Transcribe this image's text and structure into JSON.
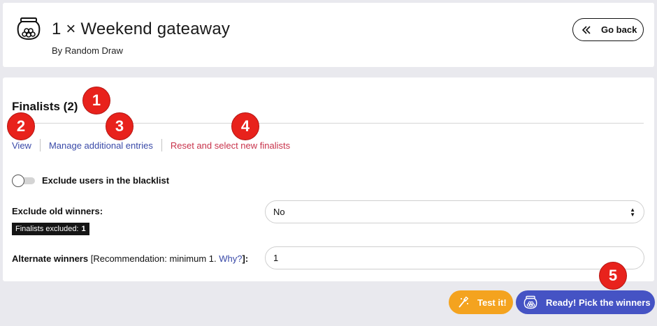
{
  "header": {
    "title": "1 × Weekend gateaway",
    "subtitle": "By Random Draw",
    "go_back_label": "Go back"
  },
  "finalists": {
    "section_title": "Finalists (2)",
    "links": {
      "view": "View",
      "manage": "Manage additional entries",
      "reset": "Reset and select new finalists"
    },
    "exclude_blacklist_label": "Exclude users in the blacklist",
    "exclude_blacklist_on": false,
    "exclude_old_winners_label": "Exclude old winners:",
    "exclude_old_winners_value": "No",
    "finalists_excluded_label": "Finalists excluded:",
    "finalists_excluded_count": "1",
    "alternate_label": "Alternate winners",
    "alternate_recommendation": "[Recommendation: minimum 1.",
    "alternate_why": "Why?",
    "alternate_close": "]:",
    "alternate_value": "1"
  },
  "actions": {
    "test_label": "Test it!",
    "pick_label": "Ready! Pick the winners"
  },
  "markers": [
    "1",
    "2",
    "3",
    "4",
    "5"
  ],
  "colors": {
    "link": "#3a4aa8",
    "reset_link": "#c8334b",
    "test_button": "#f4a31f",
    "pick_button": "#4553c4",
    "marker": "#e8221c"
  }
}
